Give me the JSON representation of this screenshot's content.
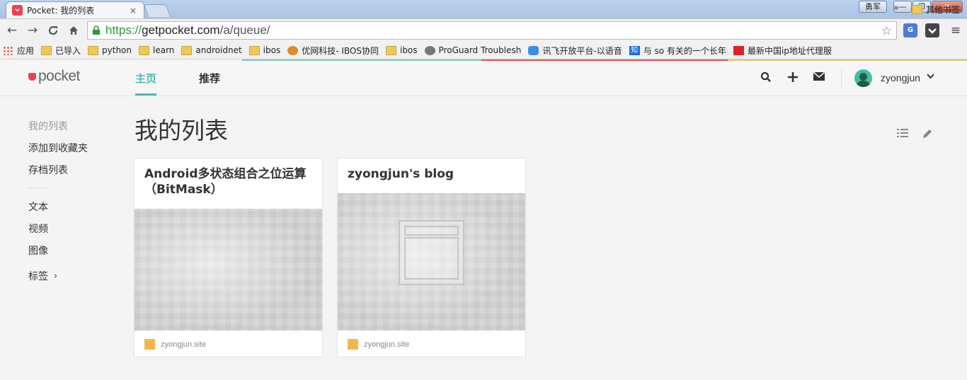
{
  "browser": {
    "tab_title": "Pocket: 我的列表",
    "tab_close": "×",
    "user_button": "勇军",
    "window_buttons": {
      "minimize": "—",
      "maximize": "❐",
      "close": "✕"
    },
    "nav": {
      "back": "←",
      "forward": "→",
      "reload": "C",
      "home": "⌂"
    },
    "url_scheme": "https://",
    "url_host": "getpocket.com",
    "url_path": "/a/queue/",
    "extensions": {
      "translate": "G"
    },
    "bookmarks": [
      {
        "label": "应用",
        "icon": "apps-icon"
      },
      {
        "label": "已导入",
        "icon": "folder-icon"
      },
      {
        "label": "python",
        "icon": "folder-icon"
      },
      {
        "label": "learn",
        "icon": "folder-icon"
      },
      {
        "label": "androidnet",
        "icon": "folder-icon"
      },
      {
        "label": "ibos",
        "icon": "folder-icon"
      },
      {
        "label": "优网科技- IBOS协同",
        "icon": "circle-icon"
      },
      {
        "label": "ibos",
        "icon": "folder-icon"
      },
      {
        "label": "ProGuard Troublesh",
        "icon": "pg-icon"
      },
      {
        "label": "讯飞开放平台-以语音",
        "icon": "xf-icon"
      },
      {
        "label": "与 so 有关的一个长年",
        "icon": "zhi-icon",
        "icon_text": "知"
      },
      {
        "label": "最新中国ip地址代理服",
        "icon": "flag-icon"
      }
    ],
    "bookmarks_more": "»",
    "bookmarks_other": "其他书签"
  },
  "app": {
    "logo_text": "pocket",
    "nav_home": "主页",
    "nav_recommend": "推荐",
    "username": "zyongjun",
    "caret": "⌄",
    "sidebar": {
      "items_top": [
        "我的列表",
        "添加到收藏夹",
        "存档列表"
      ],
      "items_bottom": [
        "文本",
        "视频",
        "图像",
        "标签"
      ],
      "tags_chevron": "›"
    },
    "page_title": "我的列表",
    "cards": [
      {
        "title": "Android多状态组合之位运算（BitMask）",
        "site": "zyongjun.site"
      },
      {
        "title": "zyongjun's blog",
        "site": "zyongjun.site"
      }
    ],
    "colors": {
      "accent": "#4fb8ad",
      "brand": "#ee4056",
      "site_favicon": "#f7b64a"
    }
  }
}
